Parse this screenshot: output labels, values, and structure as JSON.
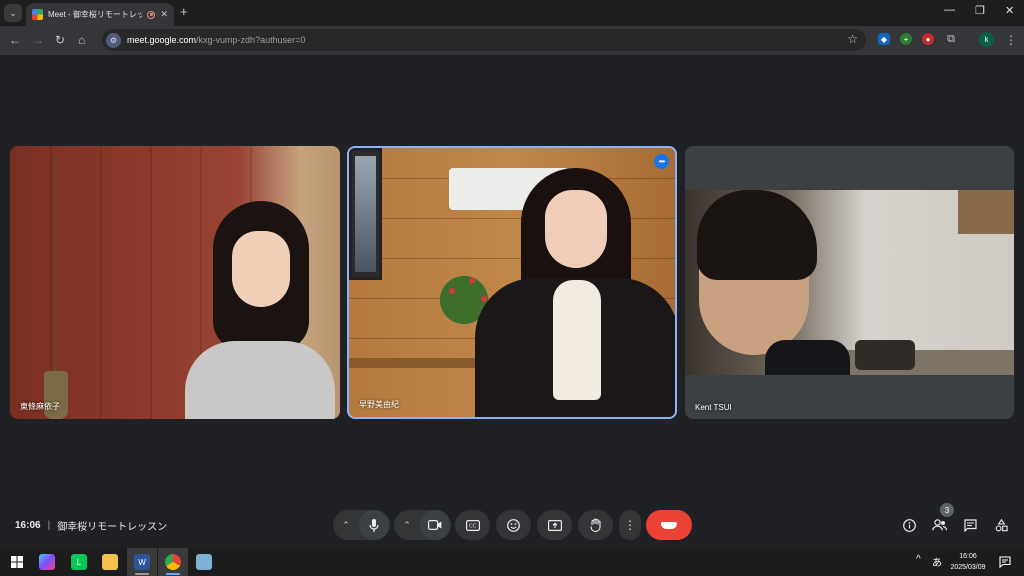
{
  "browser": {
    "tab_title": "Meet - 御幸桜リモートレッスン",
    "new_tab_label": "+",
    "url_host": "meet.google.com",
    "url_path": "/kxg-vump-zdh?authuser=0",
    "profile_initial": "k",
    "window_controls": {
      "minimize": "—",
      "restore": "❐",
      "close": "✕"
    }
  },
  "tiles": [
    {
      "name": "東條麻依子",
      "active": false
    },
    {
      "name": "早野美由紀",
      "active": true
    },
    {
      "name": "Kent TSUI",
      "active": false
    }
  ],
  "meeting": {
    "time": "16:06",
    "separator": "|",
    "title": "御幸桜リモートレッスン",
    "participant_count": "3"
  },
  "controls": {
    "more_dots": "•••",
    "end_call_color": "#ea4335",
    "active_border_color": "#8ab4f8"
  },
  "taskbar": {
    "ime": "あ",
    "clock_time": "16:06",
    "clock_date": "2025/03/09",
    "tray_up": "^"
  }
}
